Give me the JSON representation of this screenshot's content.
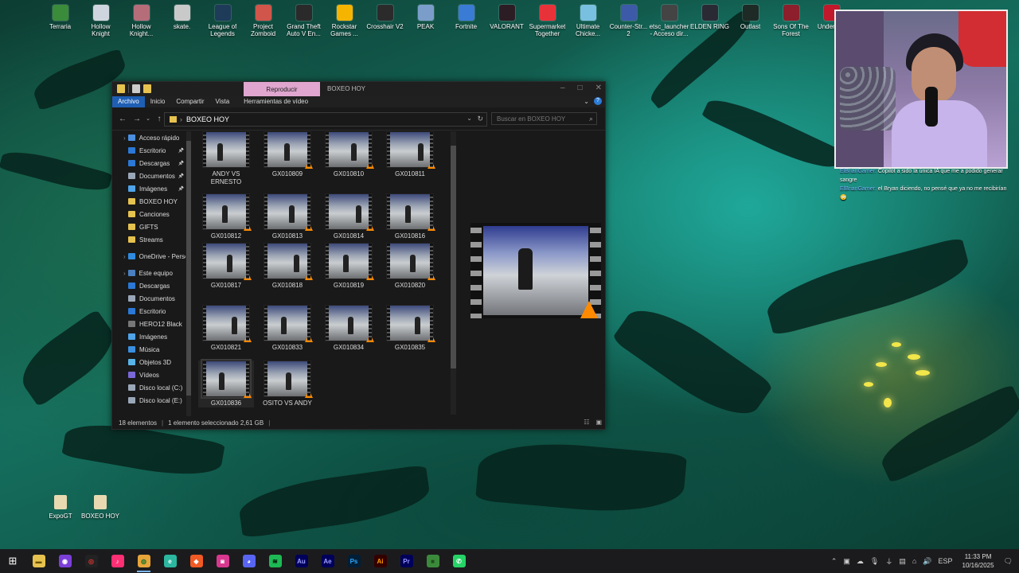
{
  "desktop": {
    "top_icons": [
      {
        "label": "Terraria",
        "color": "#3a8b3a"
      },
      {
        "label": "Hollow\nKnight",
        "color": "#cfd5de"
      },
      {
        "label": "Hollow\nKnight...",
        "color": "#b56d7a"
      },
      {
        "label": "skate.",
        "color": "#c9c9c9"
      },
      {
        "label": "League of\nLegends",
        "color": "#1e3b5a"
      },
      {
        "label": "Project\nZomboid",
        "color": "#d0554a"
      },
      {
        "label": "Grand Theft\nAuto V En...",
        "color": "#2a2a2a"
      },
      {
        "label": "Rockstar\nGames ...",
        "color": "#f5b400"
      },
      {
        "label": "Crosshair V2",
        "color": "#2b2b2b"
      },
      {
        "label": "PEAK",
        "color": "#7a9ec9"
      },
      {
        "label": "Fortnite",
        "color": "#3a7bd5"
      },
      {
        "label": "VALORANT",
        "color": "#2c1d24"
      },
      {
        "label": "Supermarket\nTogether",
        "color": "#e8323a"
      },
      {
        "label": "Ultimate\nChicke...",
        "color": "#79c0e0"
      },
      {
        "label": "Counter-Str...\n2",
        "color": "#3d5aa8"
      },
      {
        "label": "etsc_launcher\n- Acceso dir...",
        "color": "#444444"
      },
      {
        "label": "ELDEN RING",
        "color": "#2a2a35"
      },
      {
        "label": "Outlast",
        "color": "#1d2a25"
      },
      {
        "label": "Sons Of The\nForest",
        "color": "#8c1f2b"
      },
      {
        "label": "Underta...",
        "color": "#c2182b"
      }
    ],
    "bottom_icons": [
      {
        "label": "ExpoGT"
      },
      {
        "label": "BOXEO HOY"
      }
    ]
  },
  "explorer": {
    "context_tab": "Reproducir",
    "window_title": "BOXEO HOY",
    "ribbon_tabs": [
      "Archivo",
      "Inicio",
      "Compartir",
      "Vista",
      "Herramientas de vídeo"
    ],
    "address": "BOXEO HOY",
    "search_placeholder": "Buscar en BOXEO HOY",
    "sidebar": [
      {
        "label": "Acceso rápido",
        "color": "#4a8fe0",
        "top": true
      },
      {
        "label": "Escritorio",
        "color": "#2b78d6",
        "pinned": true
      },
      {
        "label": "Descargas",
        "color": "#2b78d6",
        "pinned": true
      },
      {
        "label": "Documentos",
        "color": "#9aa7b8",
        "pinned": true
      },
      {
        "label": "Imágenes",
        "color": "#4fa3e8",
        "pinned": true
      },
      {
        "label": "BOXEO HOY",
        "color": "#e6c24f"
      },
      {
        "label": "Canciones",
        "color": "#e6c24f"
      },
      {
        "label": "GIFTS",
        "color": "#e6c24f"
      },
      {
        "label": "Streams",
        "color": "#e6c24f"
      },
      {
        "label": "OneDrive - Persor",
        "color": "#2f8be0",
        "top": true,
        "gap": true
      },
      {
        "label": "Este equipo",
        "color": "#4a7fc0",
        "top": true,
        "gap": true
      },
      {
        "label": "Descargas",
        "color": "#2b78d6"
      },
      {
        "label": "Documentos",
        "color": "#9aa7b8"
      },
      {
        "label": "Escritorio",
        "color": "#2b78d6"
      },
      {
        "label": "HERO12 Black",
        "color": "#777777"
      },
      {
        "label": "Imágenes",
        "color": "#4fa3e8"
      },
      {
        "label": "Música",
        "color": "#3a8fe0"
      },
      {
        "label": "Objetos 3D",
        "color": "#58b4e8"
      },
      {
        "label": "Vídeos",
        "color": "#7a68d8"
      },
      {
        "label": "Disco local (C:)",
        "color": "#9aa7b8"
      },
      {
        "label": "Disco local (E:)",
        "color": "#9aa7b8"
      }
    ],
    "files": [
      "ANDY VS\nERNESTO",
      "GX010809",
      "GX010810",
      "GX010811",
      "GX010812",
      "GX010813",
      "GX010814",
      "GX010816",
      "GX010817",
      "GX010818",
      "GX010819",
      "GX010820",
      "GX010821",
      "GX010833",
      "GX010834",
      "GX010835",
      "GX010836",
      "OSITO VS ANDY"
    ],
    "status": {
      "count": "18 elementos",
      "selection": "1 elemento seleccionado  2,61 GB"
    }
  },
  "chat": [
    {
      "user": "ElBrianGamer:",
      "msg": "Copilot a sido la única IA que me a podido generar sangre"
    },
    {
      "user": "ElBrianGamer:",
      "msg": "el Bryan diciendo, no pensé que ya no me recibirían 😳"
    }
  ],
  "taskbar": {
    "apps": [
      {
        "name": "explorer",
        "glyph": "▬",
        "bg": "#e6c24f",
        "fg": "#6b5200"
      },
      {
        "name": "obs",
        "glyph": "◉",
        "bg": "#7b3fd8",
        "fg": "#fff"
      },
      {
        "name": "capcut",
        "glyph": "◎",
        "bg": "#222222",
        "fg": "#d33"
      },
      {
        "name": "tiktok",
        "glyph": "♪",
        "bg": "#ff2f74",
        "fg": "#fff"
      },
      {
        "name": "chrome",
        "glyph": "◍",
        "bg": "#e8a53a",
        "fg": "#2d7a2d",
        "active": true
      },
      {
        "name": "edge",
        "glyph": "e",
        "bg": "#2bb7a0",
        "fg": "#fff"
      },
      {
        "name": "brave",
        "glyph": "◆",
        "bg": "#f05a24",
        "fg": "#fff"
      },
      {
        "name": "instagram",
        "glyph": "◙",
        "bg": "#d9388f",
        "fg": "#fff"
      },
      {
        "name": "discord",
        "glyph": "◕",
        "bg": "#5865f2",
        "fg": "#fff"
      },
      {
        "name": "spotify",
        "glyph": "≋",
        "bg": "#1db954",
        "fg": "#000"
      },
      {
        "name": "audition",
        "glyph": "Au",
        "bg": "#00005b",
        "fg": "#9f9fff"
      },
      {
        "name": "after-effects",
        "glyph": "Ae",
        "bg": "#00005b",
        "fg": "#9f9fff"
      },
      {
        "name": "photoshop",
        "glyph": "Ps",
        "bg": "#001e36",
        "fg": "#31a8ff"
      },
      {
        "name": "illustrator",
        "glyph": "Ai",
        "bg": "#330000",
        "fg": "#ff9a00"
      },
      {
        "name": "premiere",
        "glyph": "Pr",
        "bg": "#00005b",
        "fg": "#9999ff"
      },
      {
        "name": "minecraft",
        "glyph": "■",
        "bg": "#3b8a3b",
        "fg": "#1d4d1d"
      },
      {
        "name": "whatsapp",
        "glyph": "✆",
        "bg": "#25d366",
        "fg": "#fff"
      }
    ],
    "language": "ESP",
    "time": "11:33 PM",
    "date": "10/16/2025"
  }
}
